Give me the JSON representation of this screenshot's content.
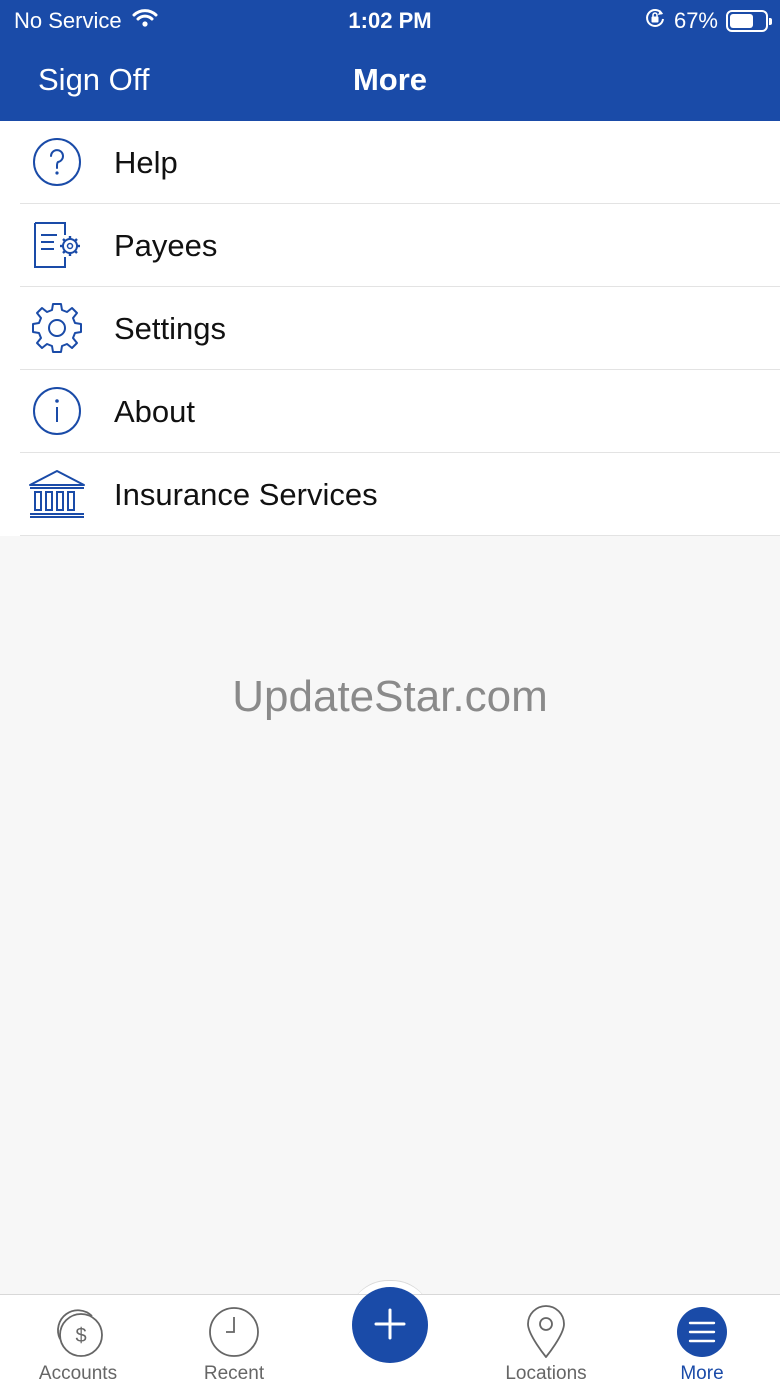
{
  "status_bar": {
    "carrier": "No Service",
    "time": "1:02 PM",
    "battery_percent": "67%",
    "battery_level": 0.67
  },
  "navbar": {
    "left_button": "Sign Off",
    "title": "More"
  },
  "menu": {
    "items": [
      {
        "label": "Help",
        "icon": "help-icon"
      },
      {
        "label": "Payees",
        "icon": "payees-icon"
      },
      {
        "label": "Settings",
        "icon": "gear-icon"
      },
      {
        "label": "About",
        "icon": "info-icon"
      },
      {
        "label": "Insurance Services",
        "icon": "bank-icon"
      }
    ]
  },
  "watermark": "UpdateStar.com",
  "tabbar": {
    "tabs": [
      {
        "label": "Accounts",
        "icon": "accounts-icon"
      },
      {
        "label": "Recent",
        "icon": "clock-icon"
      },
      {
        "label": "",
        "icon": "plus-icon"
      },
      {
        "label": "Locations",
        "icon": "location-pin-icon"
      },
      {
        "label": "More",
        "icon": "menu-icon",
        "active": true
      }
    ]
  },
  "colors": {
    "brand": "#1a4ba8",
    "background": "#f7f7f7",
    "inactive_tab": "#666666"
  }
}
